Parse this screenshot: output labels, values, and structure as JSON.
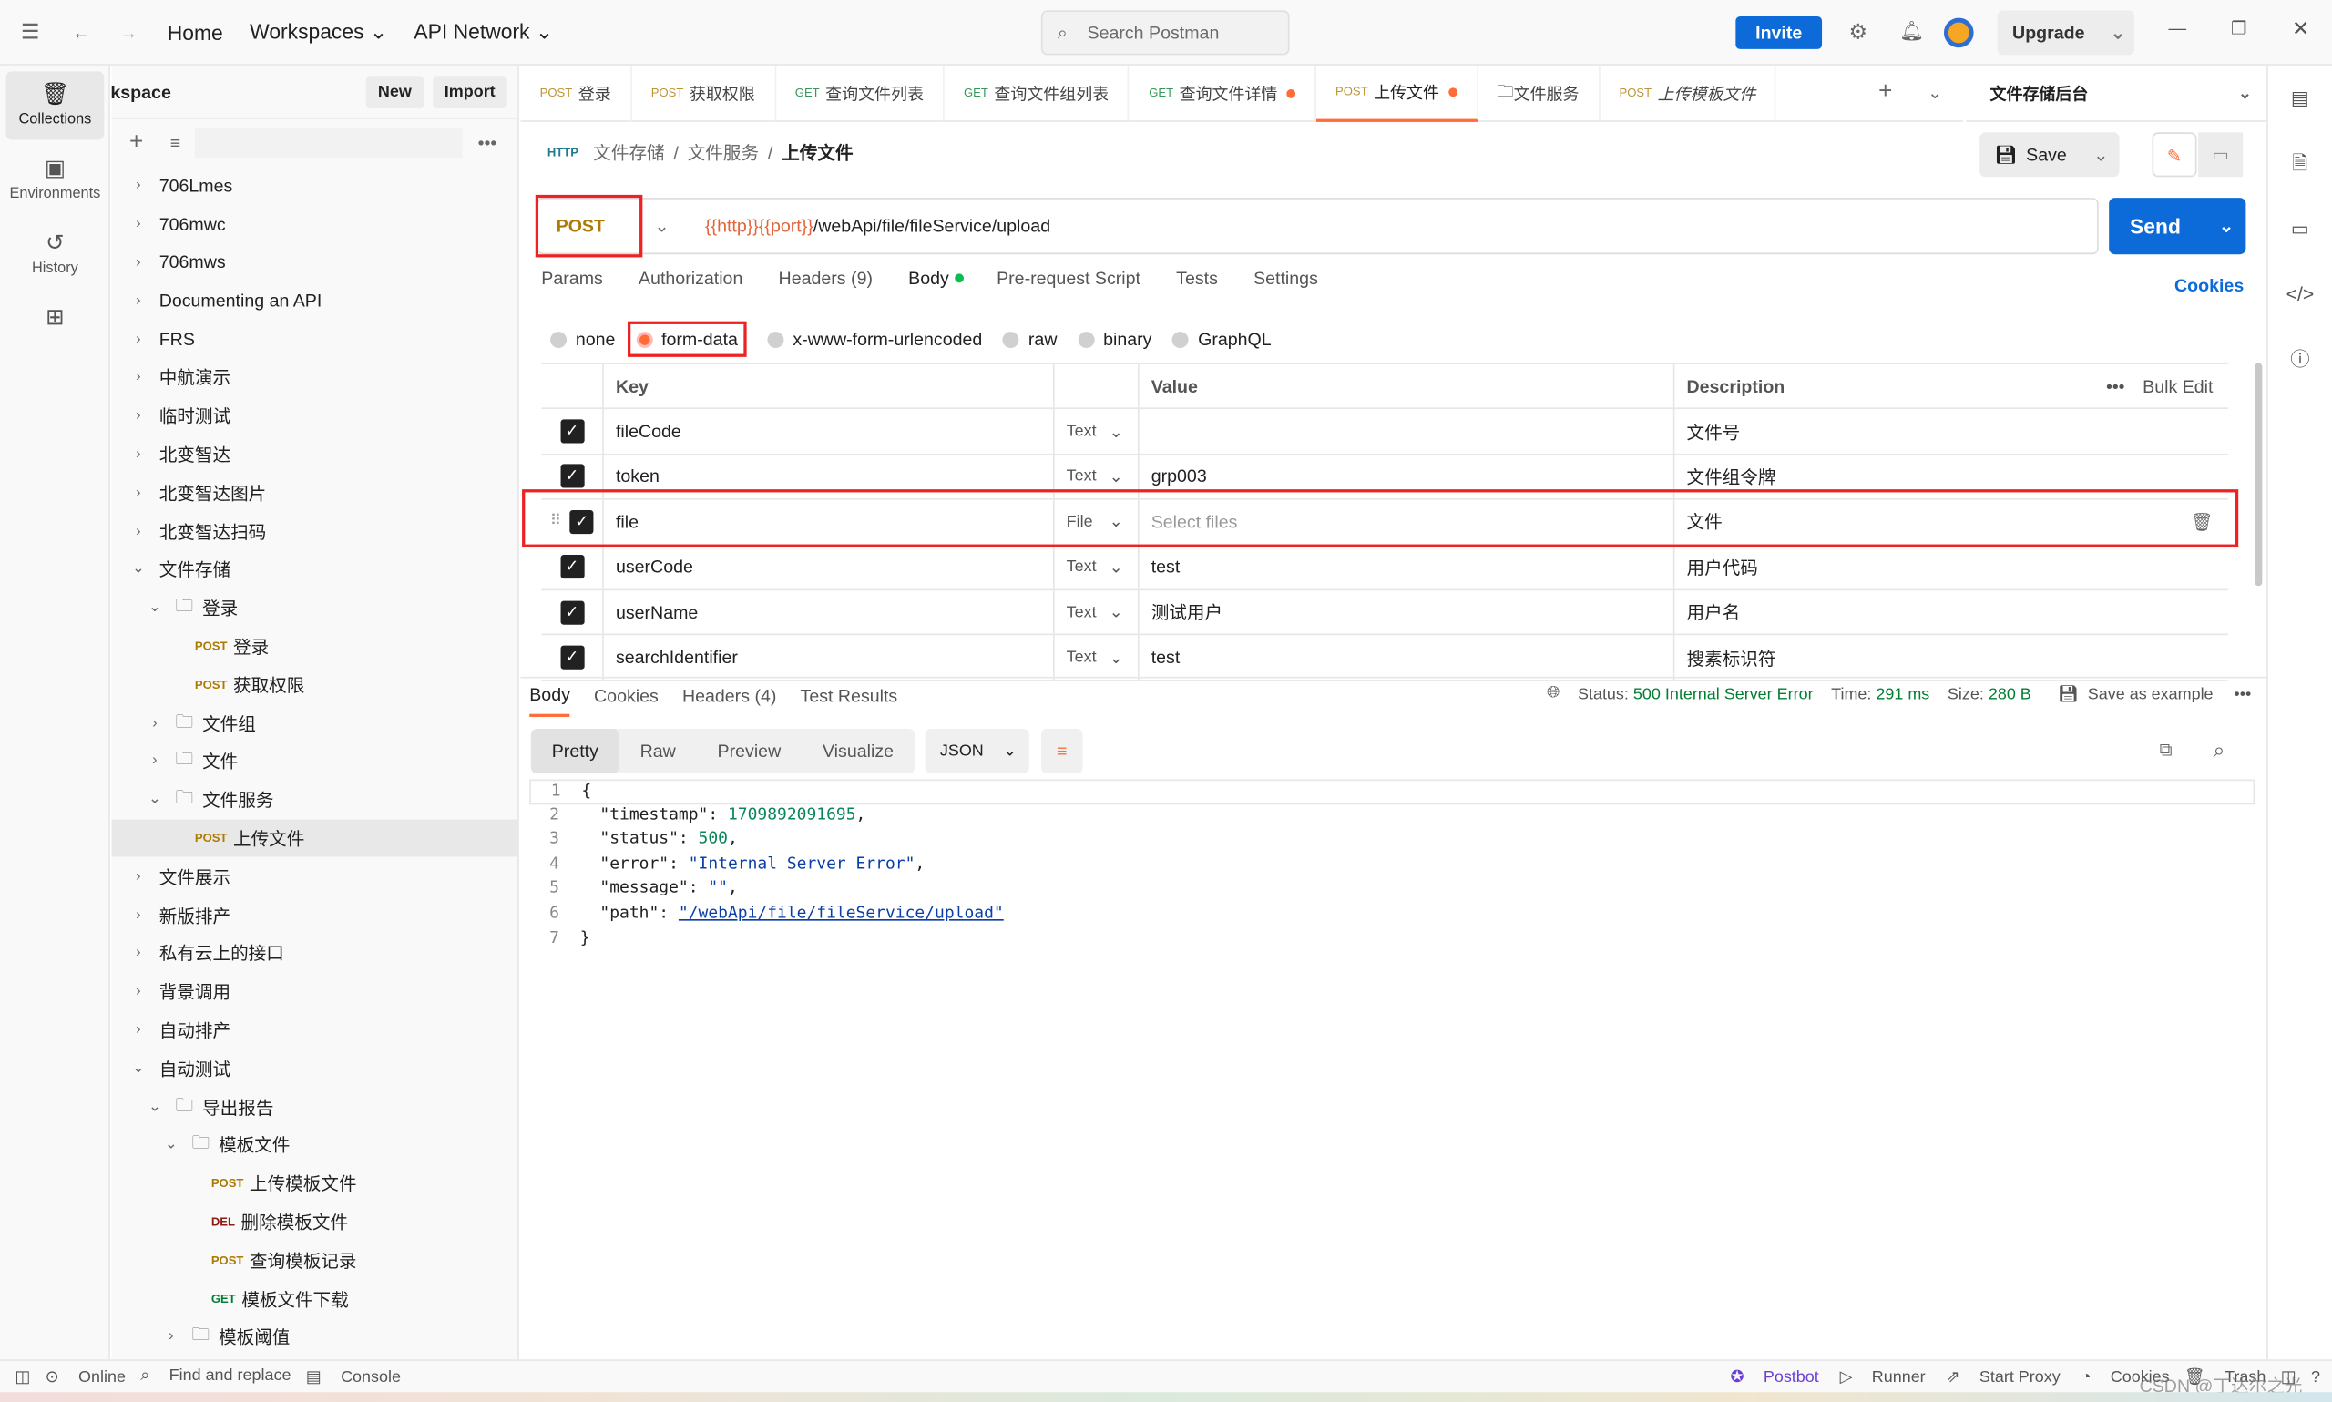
{
  "topbar": {
    "home": "Home",
    "workspaces": "Workspaces",
    "api_network": "API Network",
    "search_placeholder": "Search Postman",
    "invite": "Invite",
    "upgrade": "Upgrade"
  },
  "rail": [
    {
      "label": "Collections",
      "icon": "trash-can-icon"
    },
    {
      "label": "Environments",
      "icon": "environment-icon"
    },
    {
      "label": "History",
      "icon": "history-icon"
    }
  ],
  "workspace": {
    "name": "My Workspace",
    "new": "New",
    "import": "Import"
  },
  "tree": [
    {
      "d": 0,
      "type": "c",
      "label": "706Lmes"
    },
    {
      "d": 0,
      "type": "c",
      "label": "706mwc"
    },
    {
      "d": 0,
      "type": "c",
      "label": "706mws"
    },
    {
      "d": 0,
      "type": "c",
      "label": "Documenting an API"
    },
    {
      "d": 0,
      "type": "c",
      "label": "FRS"
    },
    {
      "d": 0,
      "type": "c",
      "label": "中航演示"
    },
    {
      "d": 0,
      "type": "c",
      "label": "临时测试"
    },
    {
      "d": 0,
      "type": "c",
      "label": "北变智达"
    },
    {
      "d": 0,
      "type": "c",
      "label": "北变智达图片"
    },
    {
      "d": 0,
      "type": "c",
      "label": "北变智达扫码"
    },
    {
      "d": 0,
      "type": "o",
      "label": "文件存储"
    },
    {
      "d": 1,
      "type": "fo",
      "label": "登录"
    },
    {
      "d": 2,
      "type": "r",
      "method": "POST",
      "label": "登录"
    },
    {
      "d": 2,
      "type": "r",
      "method": "POST",
      "label": "获取权限"
    },
    {
      "d": 1,
      "type": "fc",
      "label": "文件组"
    },
    {
      "d": 1,
      "type": "fc",
      "label": "文件"
    },
    {
      "d": 1,
      "type": "fo",
      "label": "文件服务"
    },
    {
      "d": 2,
      "type": "r",
      "method": "POST",
      "label": "上传文件",
      "selected": true
    },
    {
      "d": 0,
      "type": "c",
      "label": "文件展示"
    },
    {
      "d": 0,
      "type": "c",
      "label": "新版排产"
    },
    {
      "d": 0,
      "type": "c",
      "label": "私有云上的接口"
    },
    {
      "d": 0,
      "type": "c",
      "label": "背景调用"
    },
    {
      "d": 0,
      "type": "c",
      "label": "自动排产"
    },
    {
      "d": 0,
      "type": "o",
      "label": "自动测试"
    },
    {
      "d": 1,
      "type": "fo",
      "label": "导出报告"
    },
    {
      "d": 2,
      "type": "fo",
      "label": "模板文件"
    },
    {
      "d": 3,
      "type": "r",
      "method": "POST",
      "label": "上传模板文件"
    },
    {
      "d": 3,
      "type": "r",
      "method": "DEL",
      "label": "删除模板文件"
    },
    {
      "d": 3,
      "type": "r",
      "method": "POST",
      "label": "查询模板记录"
    },
    {
      "d": 3,
      "type": "r",
      "method": "GET",
      "label": "模板文件下载"
    },
    {
      "d": 2,
      "type": "fc",
      "label": "模板阈值"
    }
  ],
  "tabs": [
    {
      "method": "POST",
      "label": "登录"
    },
    {
      "method": "POST",
      "label": "获取权限"
    },
    {
      "method": "GET",
      "label": "查询文件列表"
    },
    {
      "method": "GET",
      "label": "查询文件组列表"
    },
    {
      "method": "GET",
      "label": "查询文件详情",
      "dirty": true
    },
    {
      "method": "POST",
      "label": "上传文件",
      "dirty": true,
      "active": true
    },
    {
      "method": "",
      "label": "文件服务",
      "folder": true
    },
    {
      "method": "POST",
      "label": "上传模板文件"
    }
  ],
  "environment": "文件存储后台",
  "breadcrumb": [
    "文件存储",
    "文件服务",
    "上传文件"
  ],
  "request": {
    "save": "Save",
    "method": "POST",
    "url_var": "{{http}}{{port}}",
    "url_path": "/webApi/file/fileService/upload",
    "send": "Send",
    "tabs": [
      "Params",
      "Authorization",
      "Headers (9)",
      "Body",
      "Pre-request Script",
      "Tests",
      "Settings"
    ],
    "cookies": "Cookies",
    "body_types": [
      "none",
      "form-data",
      "x-www-form-urlencoded",
      "raw",
      "binary",
      "GraphQL"
    ],
    "body_type_selected": "form-data",
    "columns": [
      "Key",
      "Value",
      "Description"
    ],
    "bulk_edit": "Bulk Edit",
    "rows": [
      {
        "key": "fileCode",
        "type": "Text",
        "value": "",
        "desc": "文件号"
      },
      {
        "key": "token",
        "type": "Text",
        "value": "grp003",
        "desc": "文件组令牌"
      },
      {
        "key": "file",
        "type": "File",
        "value": "",
        "placeholder": "Select files",
        "desc": "文件"
      },
      {
        "key": "userCode",
        "type": "Text",
        "value": "test",
        "desc": "用户代码"
      },
      {
        "key": "userName",
        "type": "Text",
        "value": "测试用户",
        "desc": "用户名"
      },
      {
        "key": "searchIdentifier",
        "type": "Text",
        "value": "test",
        "desc": "搜素标识符"
      }
    ]
  },
  "response": {
    "tabs": [
      "Body",
      "Cookies",
      "Headers (4)",
      "Test Results"
    ],
    "status_label": "Status:",
    "status": "500 Internal Server Error",
    "time_label": "Time:",
    "time": "291 ms",
    "size_label": "Size:",
    "size": "280 B",
    "save_example": "Save as example",
    "formats": [
      "Pretty",
      "Raw",
      "Preview",
      "Visualize"
    ],
    "lang": "JSON",
    "lines": [
      [
        "{"
      ],
      [
        "  ",
        "\"timestamp\"",
        ": ",
        "1709892091695",
        ","
      ],
      [
        "  ",
        "\"status\"",
        ": ",
        "500",
        ","
      ],
      [
        "  ",
        "\"error\"",
        ": ",
        "\"Internal Server Error\"",
        ","
      ],
      [
        "  ",
        "\"message\"",
        ": ",
        "\"\"",
        ","
      ],
      [
        "  ",
        "\"path\"",
        ": ",
        "\"/webApi/file/fileService/upload\"",
        ""
      ],
      [
        "}"
      ]
    ]
  },
  "footer": {
    "online": "Online",
    "find": "Find and replace",
    "console": "Console",
    "postbot": "Postbot",
    "runner": "Runner",
    "proxy": "Start Proxy",
    "cookies": "Cookies",
    "trash": "Trash",
    "watermark": "CSDN @丁达尔之光"
  }
}
